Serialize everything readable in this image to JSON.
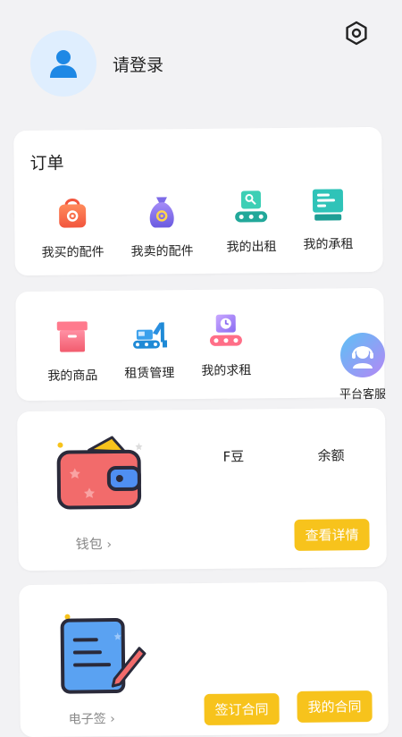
{
  "header": {
    "login_text": "请登录"
  },
  "orders": {
    "title": "订单",
    "items": [
      {
        "label": "我买的配件",
        "icon": "shopping-bag-gear-icon"
      },
      {
        "label": "我卖的配件",
        "icon": "money-bag-gear-icon"
      },
      {
        "label": "我的出租",
        "icon": "conveyor-key-icon"
      },
      {
        "label": "我的承租",
        "icon": "monitor-list-icon"
      }
    ]
  },
  "goods": {
    "items": [
      {
        "label": "我的商品",
        "icon": "box-icon"
      },
      {
        "label": "租赁管理",
        "icon": "excavator-icon"
      },
      {
        "label": "我的求租",
        "icon": "conveyor-clock-icon"
      }
    ]
  },
  "wallet": {
    "f_beans_label": "F豆",
    "balance_label": "余额",
    "wallet_link": "钱包",
    "details_button": "查看详情"
  },
  "contract": {
    "link_label": "电子签",
    "sign_button": "签订合同",
    "my_contract_button": "我的合同"
  },
  "service": {
    "label": "平台客服"
  },
  "colors": {
    "accent_yellow": "#f7c31c",
    "avatar_blue": "#1e88e5"
  }
}
